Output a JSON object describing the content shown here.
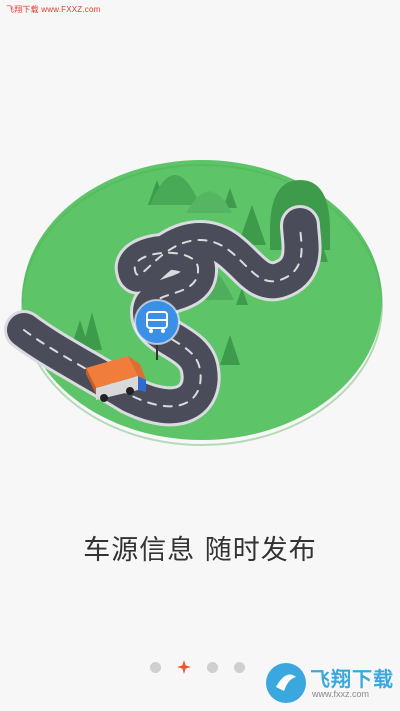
{
  "watermark": {
    "top_text": "飞翔下载 www.FXXZ.com",
    "logo_title": "飞翔下载",
    "logo_url": "www.fxxz.com"
  },
  "headline": "车源信息 随时发布",
  "pager": {
    "total": 4,
    "active_index": 1
  },
  "colors": {
    "background": "#f7f7f7",
    "ground": "#5ec468",
    "road": "#4a4d59",
    "pin": "#3c8fe6",
    "truck_cargo": "#f07d3c",
    "active_dot": "#e85a2c"
  },
  "icons": {
    "pin": "bus-location-pin-icon",
    "active_dot": "star-dot-icon"
  }
}
